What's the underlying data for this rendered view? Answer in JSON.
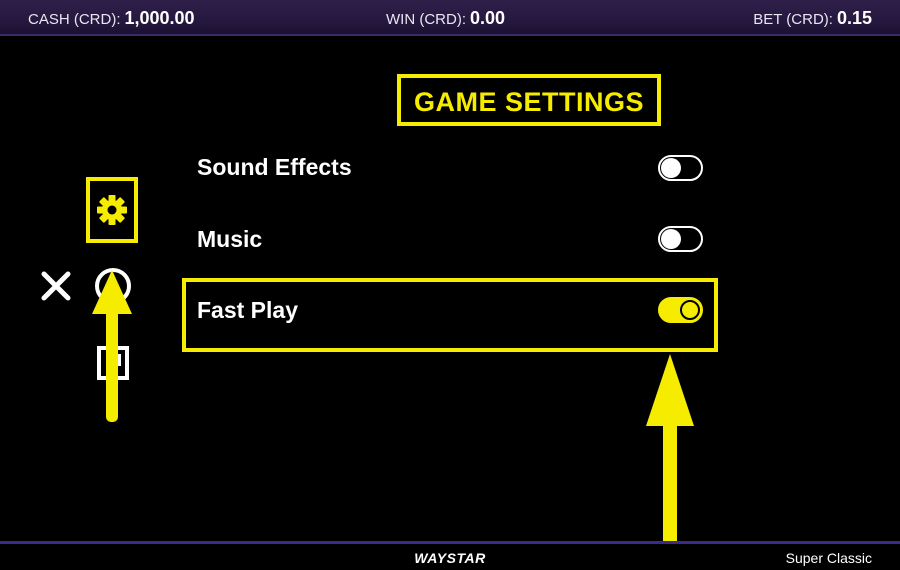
{
  "status_bar": {
    "cash_label": "CASH (CRD):",
    "cash_value": "1,000.00",
    "win_label": "WIN (CRD):",
    "win_value": "0.00",
    "bet_label": "BET (CRD):",
    "bet_value": "0.15"
  },
  "panel": {
    "title": "GAME SETTINGS",
    "settings": [
      {
        "label": "Sound Effects",
        "enabled": false
      },
      {
        "label": "Music",
        "enabled": false
      },
      {
        "label": "Fast Play",
        "enabled": true
      }
    ]
  },
  "side_menu": {
    "icons": [
      "gear-icon",
      "close-icon",
      "info-icon",
      "paytable-icon"
    ]
  },
  "footer": {
    "brand": "WAYSTAR",
    "game_name": "Super Classic"
  },
  "colors": {
    "highlight": "#f5ec00",
    "bar": "#2e1f4a",
    "footer_border": "#3c2a8a"
  }
}
